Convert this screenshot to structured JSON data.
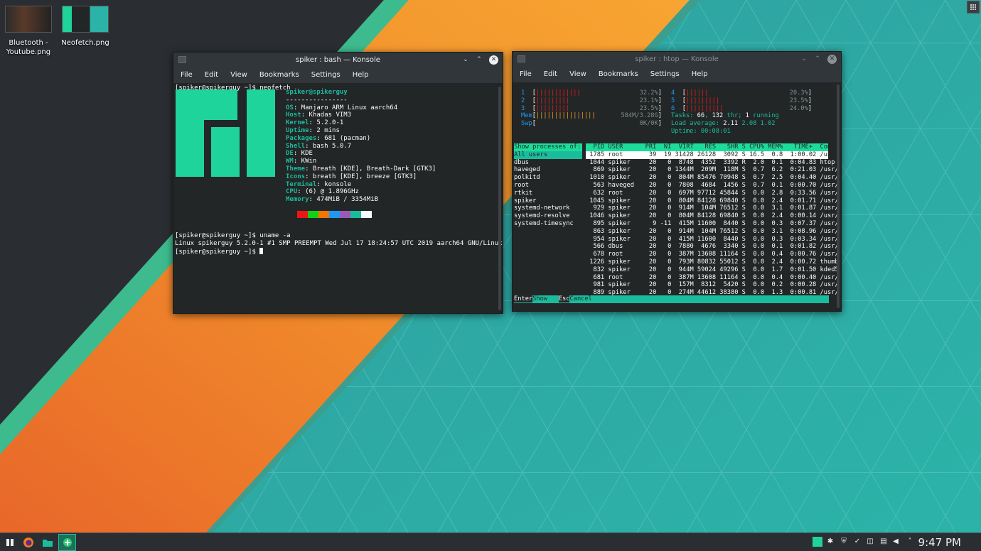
{
  "desktop": {
    "icons": [
      {
        "label": "Bluetooth -\nYoutube.png",
        "line1": "Bluetooth -",
        "line2": "Youtube.png"
      },
      {
        "label": "Neofetch.png",
        "line1": "Neofetch.png",
        "line2": ""
      }
    ]
  },
  "win1": {
    "title": "spiker : bash — Konsole",
    "menu": [
      "File",
      "Edit",
      "View",
      "Bookmarks",
      "Settings",
      "Help"
    ],
    "prompt1": "[spiker@spikerguy ~]$ neofetch",
    "user_host": "spiker@spikerguy",
    "separator": "----------------",
    "info": [
      {
        "k": "OS",
        "v": ": Manjaro ARM Linux aarch64"
      },
      {
        "k": "Host",
        "v": ": Khadas VIM3"
      },
      {
        "k": "Kernel",
        "v": ": 5.2.0-1"
      },
      {
        "k": "Uptime",
        "v": ": 2 mins"
      },
      {
        "k": "Packages",
        "v": ": 681 (pacman)"
      },
      {
        "k": "Shell",
        "v": ": bash 5.0.7"
      },
      {
        "k": "DE",
        "v": ": KDE"
      },
      {
        "k": "WM",
        "v": ": KWin"
      },
      {
        "k": "Theme",
        "v": ": Breath [KDE], Breath-Dark [GTK3]"
      },
      {
        "k": "Icons",
        "v": ": breath [KDE], breeze [GTK3]"
      },
      {
        "k": "Terminal",
        "v": ": konsole"
      },
      {
        "k": "CPU",
        "v": ": (6) @ 1.896GHz"
      },
      {
        "k": "Memory",
        "v": ": 474MiB / 3354MiB"
      }
    ],
    "palette": [
      "#ed1515",
      "#11d116",
      "#f67400",
      "#1d99f3",
      "#9b59b6",
      "#1abc9c",
      "#fcfcfc"
    ],
    "prompt2": "[spiker@spikerguy ~]$ uname -a",
    "uname_out": "Linux spikerguy 5.2.0-1 #1 SMP PREEMPT Wed Jul 17 18:24:57 UTC 2019 aarch64 GNU/Linux",
    "prompt3": "[spiker@spikerguy ~]$ "
  },
  "win2": {
    "title": "spiker : htop — Konsole",
    "menu": [
      "File",
      "Edit",
      "View",
      "Bookmarks",
      "Settings",
      "Help"
    ],
    "cpus": [
      {
        "n": "1",
        "bars": "||||||||||||",
        "pct": "32.2%"
      },
      {
        "n": "2",
        "bars": "|||||||||",
        "pct": "23.1%"
      },
      {
        "n": "3",
        "bars": "|||||||||",
        "pct": "23.5%"
      },
      {
        "n": "4",
        "bars": "||||||",
        "pct": "20.3%"
      },
      {
        "n": "5",
        "bars": "|||||||||",
        "pct": "23.5%"
      },
      {
        "n": "6",
        "bars": "||||||||||",
        "pct": "24.0%"
      }
    ],
    "mem": {
      "label": "Mem",
      "bars": "||||||||||||||||",
      "val": "584M/3.28G"
    },
    "swp": {
      "label": "Swp",
      "val": "0K/0K"
    },
    "tasks": {
      "label": "Tasks:",
      "n": "66",
      "sep": ",",
      "thr": "132",
      "thr_label": "thr;",
      "running": "1",
      "running_label": "running"
    },
    "load": {
      "label": "Load average:",
      "a": "2.11",
      "b": "2.08",
      "c": "1.02"
    },
    "uptime": {
      "label": "Uptime:",
      "val": "00:08:01"
    },
    "filter_title": "Show processes of:",
    "filter_items": [
      "All users",
      "dbus",
      "haveged",
      "polkitd",
      "root",
      "rtkit",
      "spiker",
      "systemd-network",
      "systemd-resolve",
      "systemd-timesync"
    ],
    "header": "  PID USER      PRI  NI  VIRT   RES   SHR S CPU% MEM%   TIME+  Comma",
    "rows": [
      " 1785 root       39  19 31428 26128  3092 S 16.5  0.8  1:00.02 /usr/",
      " 1044 spiker     20   0  8748  4352  3392 R  2.0  0.1  0:04.83 htop",
      "  869 spiker     20   0 1344M  209M  118M S  0.7  6.2  0:21.03 /usr/",
      " 1010 spiker     20   0  804M 85476 70948 S  0.7  2.5  0:04.40 /usr/",
      "  563 haveged    20   0  7808  4684  1456 S  0.7  0.1  0:00.70 /usr/",
      "  632 root       20   0  697M 97712 45844 S  0.0  2.8  0:33.56 /usr/",
      " 1045 spiker     20   0  804M 84128 69840 S  0.0  2.4  0:01.71 /usr/",
      "  929 spiker     20   0  914M  104M 76512 S  0.0  3.1  0:01.87 /usr/",
      " 1046 spiker     20   0  804M 84128 69840 S  0.0  2.4  0:00.14 /usr/",
      "  895 spiker      9 -11  415M 11600  8440 S  0.0  0.3  0:07.37 /usr/",
      "  863 spiker     20   0  914M  104M 76512 S  0.0  3.1  0:08.96 /usr/",
      "  954 spiker     20   0  415M 11600  8440 S  0.0  0.3  0:03.34 /usr/",
      "  566 dbus       20   0  7880  4676  3340 S  0.0  0.1  0:01.82 /usr/",
      "  678 root       20   0  387M 13608 11164 S  0.0  0.4  0:00.76 /usr/",
      " 1226 spiker     20   0  793M 80832 55012 S  0.0  2.4  0:00.72 thumb",
      "  832 spiker     20   0  944M 59024 49296 S  0.0  1.7  0:01.50 kded5",
      "  681 root       20   0  387M 13608 11164 S  0.0  0.4  0:00.40 /usr/",
      "  981 spiker     20   0  157M  8312  5420 S  0.0  0.2  0:00.28 /usr/",
      "  889 spiker     20   0  274M 44612 38380 S  0.0  1.3  0:00.81 /usr/"
    ],
    "footer": {
      "k1": "Enter",
      "v1": "Show   ",
      "k2": "Esc",
      "v2": "Cancel"
    }
  },
  "taskbar": {
    "clock": "9:47 PM"
  }
}
